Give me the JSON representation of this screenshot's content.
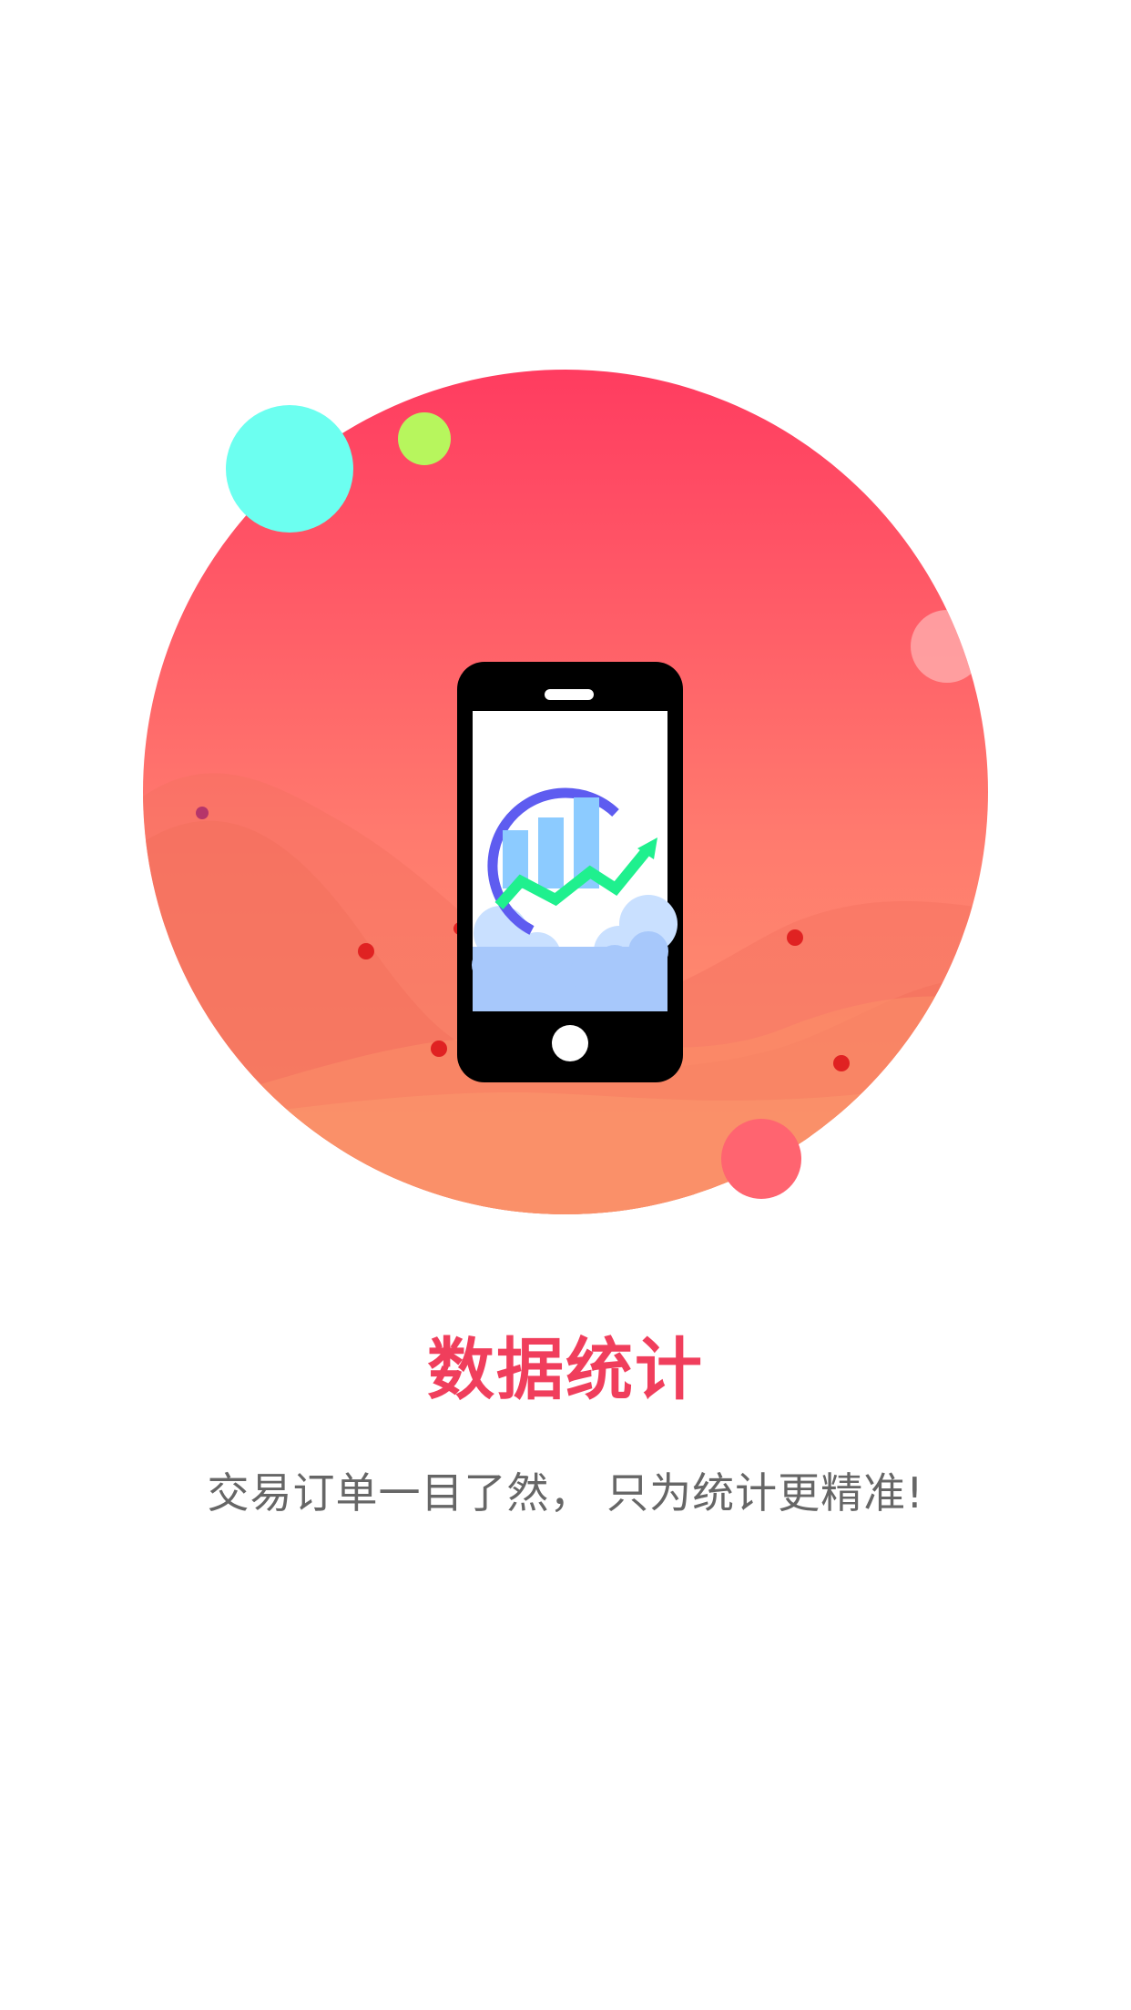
{
  "onboarding": {
    "title": "数据统计",
    "subtitle": "交易订单一目了然， 只为统计更精准!"
  },
  "illustration": {
    "icon": "phone-with-growth-chart-icon"
  },
  "colors": {
    "accent": "#F03E5C",
    "subtitle": "#666666",
    "circle_top": "#FF3C60",
    "circle_bottom": "#FD9A6E",
    "bubble_cyan": "#6CFFF0",
    "bubble_lime": "#B7F65D",
    "bubble_coral": "#FF6470",
    "chart_bars": "#8CCBFF",
    "chart_arc": "#5E5CF0",
    "chart_arrow": "#1FF08E"
  }
}
